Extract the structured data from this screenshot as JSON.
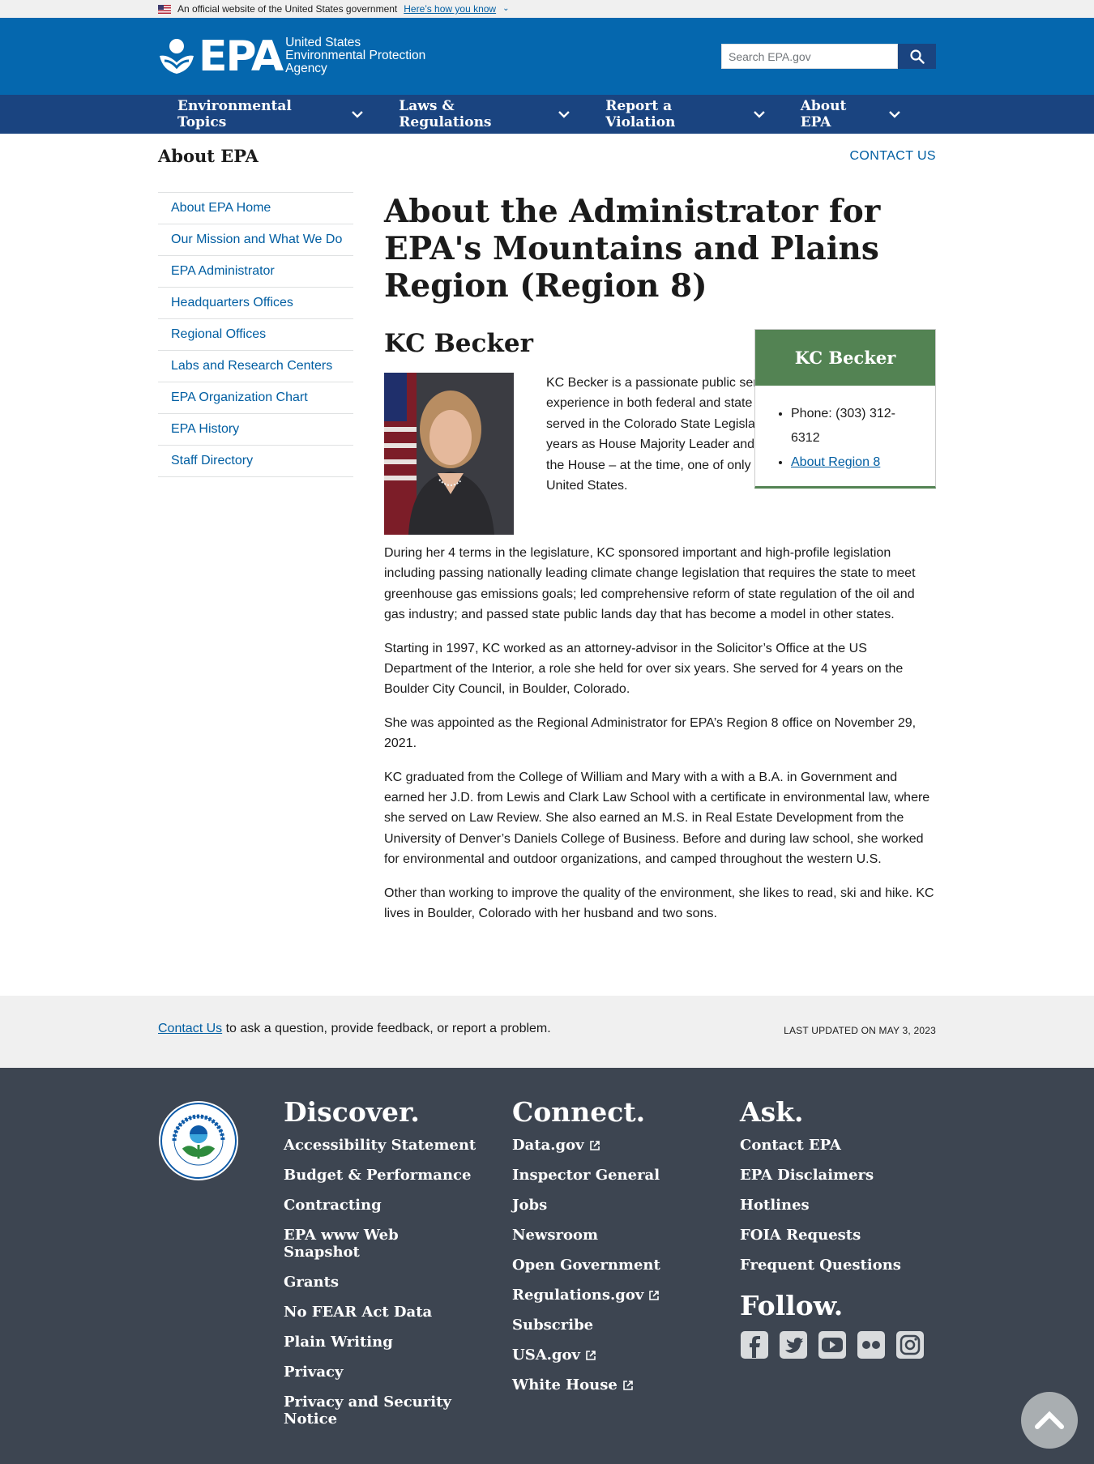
{
  "banner": {
    "official_text": "An official website of the United States government",
    "how_link": "Here’s how you know"
  },
  "header": {
    "logo_text": "EPA",
    "agency_lines": [
      "United States",
      "Environmental Protection",
      "Agency"
    ],
    "search_placeholder": "Search EPA.gov",
    "search_icon": "search-icon"
  },
  "nav": {
    "items": [
      "Environmental Topics",
      "Laws & Regulations",
      "Report a Violation",
      "About EPA"
    ]
  },
  "section": {
    "title": "About EPA",
    "contact": "CONTACT US"
  },
  "sidenav": {
    "items": [
      "About EPA Home",
      "Our Mission and What We Do",
      "EPA Administrator",
      "Headquarters Offices",
      "Regional Offices",
      "Labs and Research Centers",
      "EPA Organization Chart",
      "EPA History",
      "Staff Directory"
    ]
  },
  "content": {
    "title": "About the Administrator for EPA's Mountains and Plains Region (Region 8)",
    "name": "KC Becker",
    "box": {
      "title": "KC Becker",
      "phone": "Phone: (303) 312-6312",
      "region_link": "About Region 8"
    },
    "paragraphs": [
      "KC Becker is a passionate public servant with over 18 years of experience in both federal and state organizations.  Recently, she served in the Colorado State Legislature for 4 terms, including two years as House Majority Leader and two years as the Speaker of the House – at the time, one of only seven female speakers in the United States.",
      "During her 4 terms in the legislature, KC sponsored important and high-profile legislation including passing nationally leading climate change legislation that requires the state to meet greenhouse gas emissions goals; led comprehensive reform of state regulation of the oil and gas industry; and passed state public lands day that has become a model in other states.",
      "Starting in 1997, KC worked as an attorney-advisor in the Solicitor’s Office at the US Department of the Interior, a role she held for over six years.  She served for 4 years on the Boulder City Council, in Boulder, Colorado.",
      "She was appointed as the Regional Administrator for EPA’s Region 8 office on November 29, 2021.",
      "KC graduated from the College of William and Mary with a with a B.A. in Government and earned her J.D. from Lewis and Clark Law School with a certificate in environmental law, where she served on Law Review. She also earned an M.S. in Real Estate Development from the University of Denver’s Daniels College of Business. Before and during law school, she worked for environmental and outdoor organizations, and camped throughout the western U.S.",
      "Other than working to improve the quality of the environment, she likes to read, ski and hike. KC lives in Boulder, Colorado with her husband and two sons."
    ]
  },
  "contact_bar": {
    "link": "Contact Us",
    "text": " to ask a question, provide feedback, or report a problem.",
    "updated": "LAST UPDATED ON MAY 3, 2023"
  },
  "footer": {
    "discover": {
      "heading": "Discover.",
      "links": [
        "Accessibility Statement",
        "Budget & Performance",
        "Contracting",
        "EPA www Web Snapshot",
        "Grants",
        "No FEAR Act Data",
        "Plain Writing",
        "Privacy",
        "Privacy and Security Notice"
      ]
    },
    "connect": {
      "heading": "Connect.",
      "links": [
        "Data.gov",
        "Inspector General",
        "Jobs",
        "Newsroom",
        "Open Government",
        "Regulations.gov",
        "Subscribe",
        "USA.gov",
        "White House"
      ]
    },
    "ask": {
      "heading": "Ask.",
      "links": [
        "Contact EPA",
        "EPA Disclaimers",
        "Hotlines",
        "FOIA Requests",
        "Frequent Questions"
      ]
    },
    "follow": {
      "heading": "Follow.",
      "social": [
        "facebook-icon",
        "twitter-icon",
        "youtube-icon",
        "flickr-icon",
        "instagram-icon"
      ]
    }
  },
  "colors": {
    "header_blue": "#0567ae",
    "nav_blue": "#1a4480",
    "box_green": "#538353",
    "footer_gray": "#3d4551"
  }
}
